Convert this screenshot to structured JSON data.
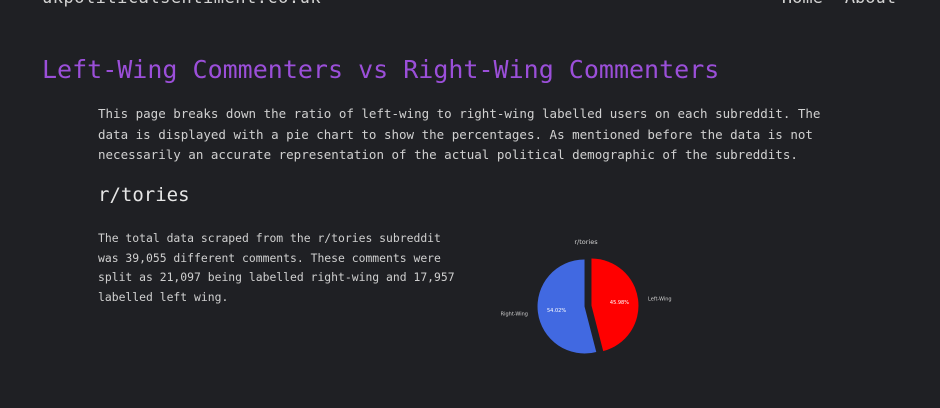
{
  "header": {
    "site_name": "ukpoliticalsentiment.co.uk",
    "nav": [
      {
        "label": "Home"
      },
      {
        "label": "About"
      }
    ]
  },
  "main": {
    "title": "Left-Wing Commenters vs Right-Wing Commenters",
    "intro": "This page breaks down the ratio of left-wing to right-wing labelled users on each subreddit. The data is displayed with a pie chart to show the percentages. As mentioned before the data is not necessarily an accurate representation of the actual political demographic of the subreddits.",
    "sections": [
      {
        "heading": "r/tories",
        "text": "The total data scraped from the r/tories subreddit was 39,055 different comments. These comments were split as 21,097 being labelled right-wing and 17,957 labelled left wing."
      }
    ]
  },
  "colors": {
    "background": "#1f2024",
    "title_accent": "#9b4fd9",
    "left_wing": "#ff0000",
    "right_wing": "#4169e1"
  },
  "chart_data": {
    "type": "pie",
    "title": "r/tories",
    "labels": [
      "Left-Wing",
      "Right-Wing"
    ],
    "values": [
      45.98,
      54.02
    ],
    "value_labels": [
      "45.98%",
      "54.02%"
    ],
    "colors": [
      "#ff0000",
      "#4169e1"
    ],
    "exploded": true
  }
}
